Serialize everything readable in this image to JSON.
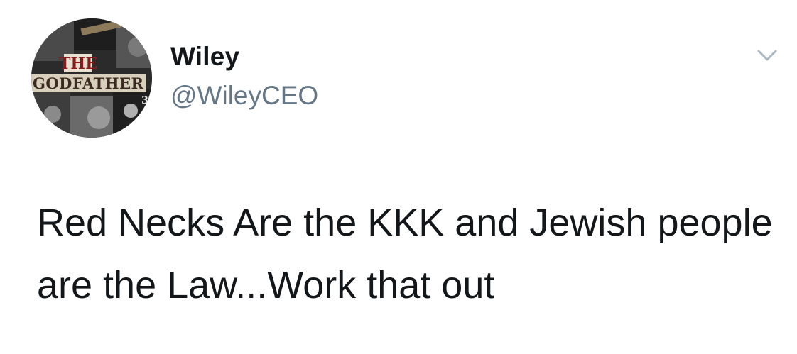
{
  "tweet": {
    "display_name": "Wiley",
    "handle": "@WileyCEO",
    "text": "Red Necks Are the KKK and Jewish people are the Law...Work that out",
    "avatar": {
      "icon": "avatar-collage-image",
      "logo_line1": "THE",
      "logo_line2": "GODFATHER",
      "logo_number": "3"
    },
    "menu_icon": "chevron-down-icon"
  },
  "colors": {
    "text": "#14171a",
    "secondary": "#657786",
    "chevron": "#aab8c2",
    "background": "#ffffff"
  }
}
